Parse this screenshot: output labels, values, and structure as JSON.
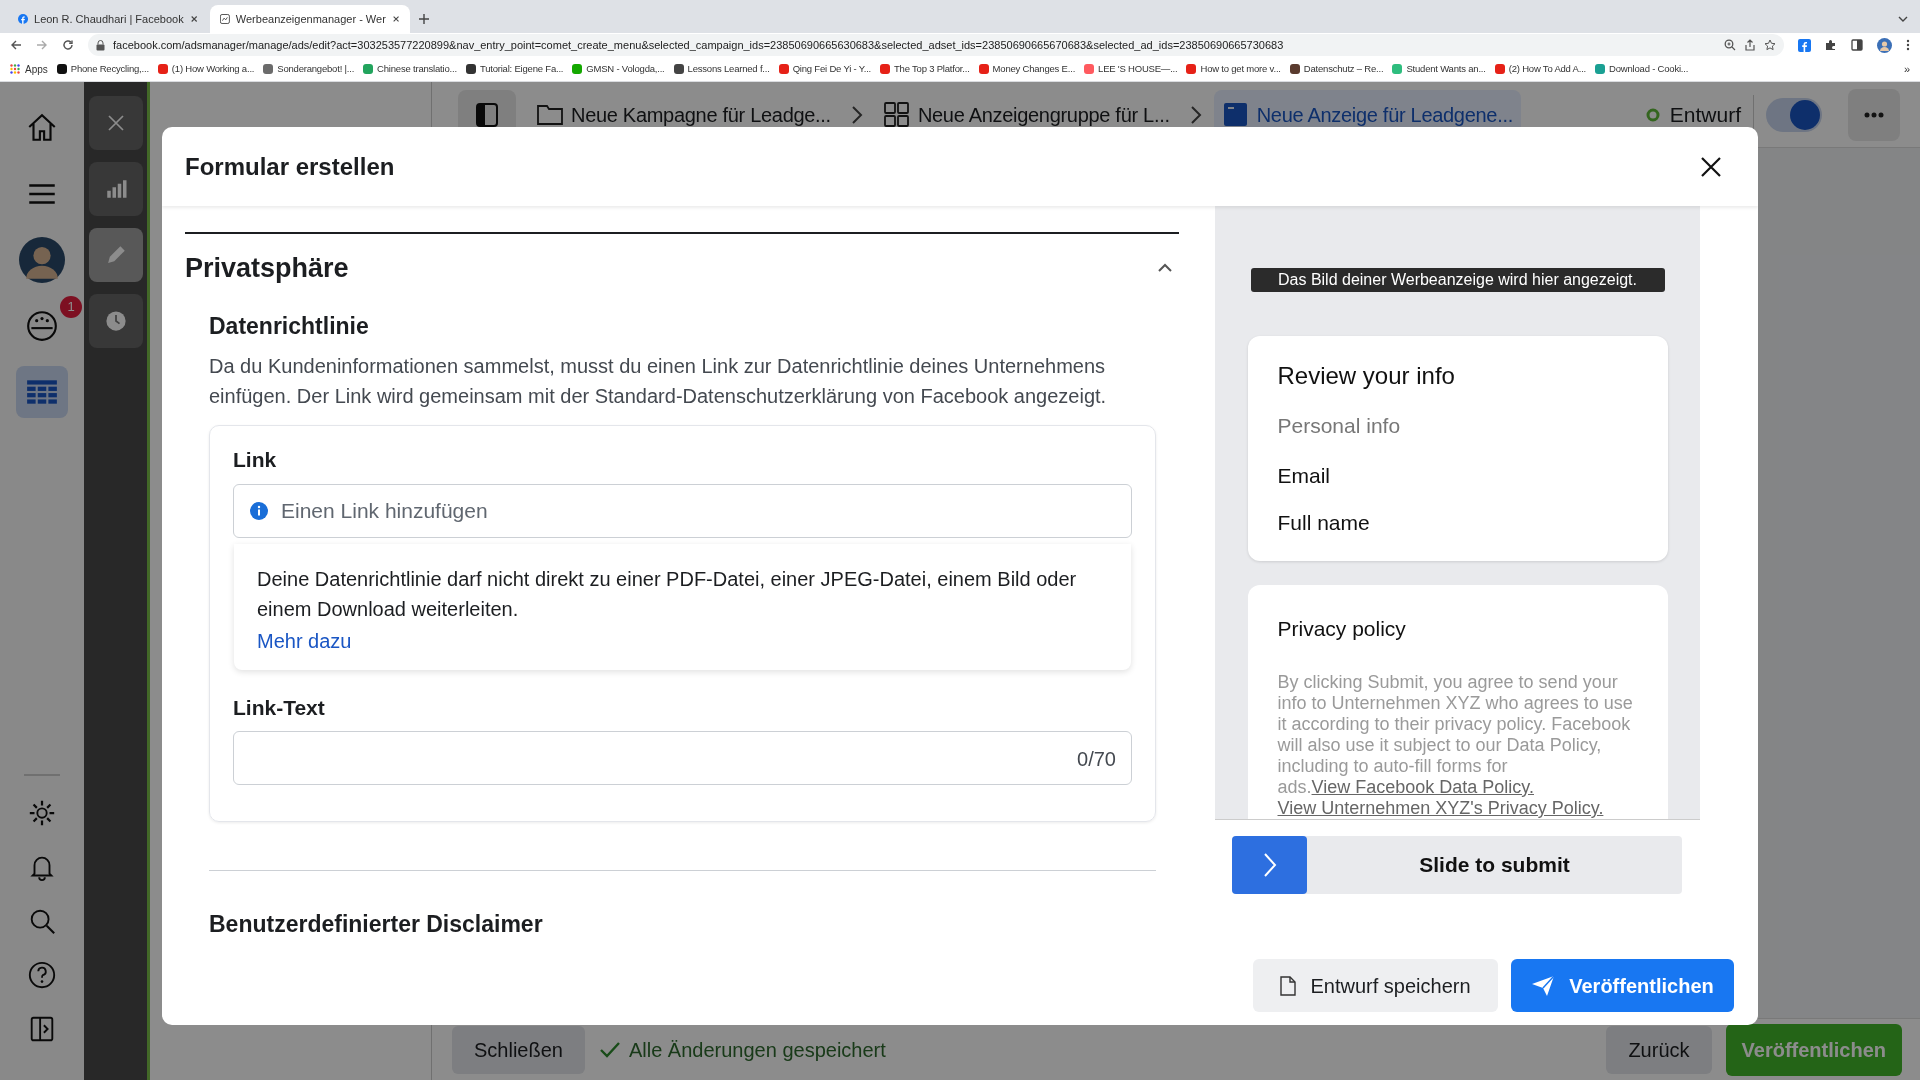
{
  "browser": {
    "tabs": [
      {
        "title": "Leon R. Chaudhari | Facebook",
        "selected": false
      },
      {
        "title": "Werbeanzeigenmanager - Wer",
        "selected": true
      }
    ],
    "url": "facebook.com/adsmanager/manage/ads/edit?act=303253577220899&nav_entry_point=comet_create_menu&selected_campaign_ids=23850690665630683&selected_adset_ids=23850690665670683&selected_ad_ids=23850690665730683",
    "apps_label": "Apps",
    "bookmarks": [
      {
        "label": "Phone Recycling,...",
        "color": "#111111"
      },
      {
        "label": "(1) How Working a...",
        "color": "#e62117"
      },
      {
        "label": "Sonderangebot! |...",
        "color": "#6b6b6b"
      },
      {
        "label": "Chinese translatio...",
        "color": "#22a45d"
      },
      {
        "label": "Tutorial: Eigene Fa...",
        "color": "#333333"
      },
      {
        "label": "GMSN - Vologda,...",
        "color": "#14a800"
      },
      {
        "label": "Lessons Learned f...",
        "color": "#444444"
      },
      {
        "label": "Qing Fei De Yi - Y...",
        "color": "#e62117"
      },
      {
        "label": "The Top 3 Platfor...",
        "color": "#e62117"
      },
      {
        "label": "Money Changes E...",
        "color": "#e62117"
      },
      {
        "label": "LEE 'S HOUSE—...",
        "color": "#ff5a5f"
      },
      {
        "label": "How to get more v...",
        "color": "#e62117"
      },
      {
        "label": "Datenschutz – Re...",
        "color": "#5a3b2e"
      },
      {
        "label": "Student Wants an...",
        "color": "#2ebd7e"
      },
      {
        "label": "(2) How To Add A...",
        "color": "#e62117"
      },
      {
        "label": "Download - Cooki...",
        "color": "#1aa093"
      }
    ],
    "more_bookmarks": "»"
  },
  "app_rail": {
    "items": [
      {
        "kind": "home",
        "selected": false
      },
      {
        "kind": "menu",
        "selected": false
      },
      {
        "kind": "avatar",
        "selected": false
      },
      {
        "kind": "gauge",
        "selected": false,
        "badge": "1"
      },
      {
        "kind": "grid",
        "selected": true
      }
    ],
    "bottom_items": [
      {
        "kind": "settings"
      },
      {
        "kind": "bell"
      },
      {
        "kind": "search"
      },
      {
        "kind": "help"
      },
      {
        "kind": "panel"
      }
    ]
  },
  "tool_rail": {
    "items": [
      {
        "kind": "close",
        "selected": false
      },
      {
        "kind": "chart",
        "selected": false
      },
      {
        "kind": "pencil",
        "selected": true
      },
      {
        "kind": "clock",
        "selected": false
      }
    ]
  },
  "breadcrumb": {
    "items": [
      {
        "kind": "campaign",
        "label": "Neue Kampagne für Leadge...",
        "selected": false
      },
      {
        "kind": "adset",
        "label": "Neue Anzeigengruppe für L...",
        "selected": false
      },
      {
        "kind": "ad",
        "label": "Neue Anzeige für Leadgene...",
        "selected": true
      }
    ],
    "status": "Entwurf",
    "toggle_on": true
  },
  "footer": {
    "close": "Schließen",
    "saved": "Alle Änderungen gespeichert",
    "back": "Zurück",
    "publish": "Veröffentlichen"
  },
  "modal": {
    "title": "Formular erstellen",
    "section": {
      "title": "Privatsphäre",
      "expanded": true
    },
    "subsection": "Datenrichtlinie",
    "description": "Da du Kundeninformationen sammelst, musst du einen Link zur Datenrichtlinie deines Unternehmens einfügen. Der Link wird gemeinsam mit der Standard-Datenschutzerklärung von Facebook angezeigt.",
    "link_label": "Link",
    "link_field": {
      "placeholder": "Einen Link hinzufügen"
    },
    "link_hint": "Deine Datenrichtlinie darf nicht direkt zu einer PDF-Datei, einer JPEG-Datei, einem Bild oder einem Download weiterleiten.",
    "learn_more": "Mehr dazu",
    "link_text_label": "Link-Text",
    "link_text_counter": "0/70",
    "next_section": "Benutzerdefinierter Disclaimer",
    "preview": {
      "image_caption": "Das Bild deiner Werbeanzeige wird hier angezeigt.",
      "review_title": "Review your info",
      "review_subtitle": "Personal info",
      "review_fields": [
        "Email",
        "Full name"
      ],
      "privacy_title": "Privacy policy",
      "privacy_text": "By clicking Submit, you agree to send your info to Unternehmen XYZ who agrees to use it according to their privacy policy. Facebook will also use it subject to our Data Policy, including to auto-fill forms for ads.",
      "privacy_links": [
        "View Facebook Data Policy.",
        "View Unternehmen XYZ's Privacy Policy."
      ],
      "slide_label": "Slide to submit"
    },
    "buttons": {
      "save_draft": "Entwurf speichern",
      "publish": "Veröffentlichen"
    }
  }
}
